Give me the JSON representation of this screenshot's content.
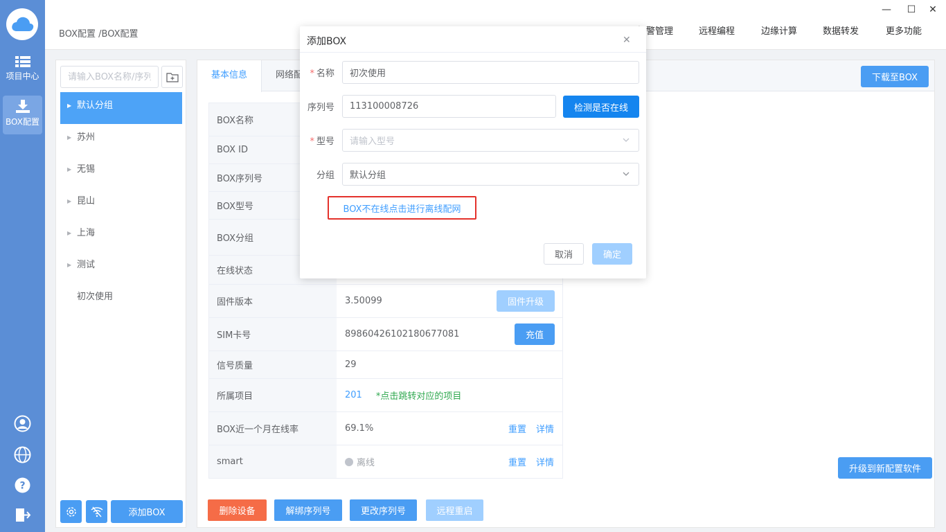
{
  "rail": {
    "items": [
      {
        "label": "项目中心"
      },
      {
        "label": "BOX配置"
      }
    ]
  },
  "topbar": {
    "breadcrumb": "BOX配置 /BOX配置",
    "nav": [
      "报警管理",
      "远程编程",
      "边缘计算",
      "数据转发",
      "更多功能"
    ]
  },
  "sidebar": {
    "search_placeholder": "请输入BOX名称/序列",
    "tree": [
      "默认分组",
      "苏州",
      "无锡",
      "昆山",
      "上海",
      "测试",
      "初次使用"
    ],
    "add_box_label": "添加BOX"
  },
  "main": {
    "tabs": [
      "基本信息",
      "网络配"
    ],
    "download_label": "下载至BOX",
    "upgrade_software_label": "升级到新配置软件",
    "rows": [
      {
        "label": "BOX名称",
        "value": ""
      },
      {
        "label": "BOX ID",
        "value": ""
      },
      {
        "label": "BOX序列号",
        "value": ""
      },
      {
        "label": "BOX型号",
        "value": ""
      },
      {
        "label": "BOX分组",
        "value": ""
      },
      {
        "label": "在线状态",
        "value": ""
      },
      {
        "label": "固件版本",
        "value": "3.50099",
        "action": "固件升级"
      },
      {
        "label": "SIM卡号",
        "value": "89860426102180677081",
        "action": "充值"
      },
      {
        "label": "信号质量",
        "value": "29"
      },
      {
        "label": "所属项目",
        "value": "201",
        "note": "*点击跳转对应的项目"
      },
      {
        "label": "BOX近一个月在线率",
        "value": "69.1%",
        "reset": "重置",
        "detail": "详情"
      },
      {
        "label": "smart",
        "value": "离线",
        "reset": "重置",
        "detail": "详情"
      }
    ],
    "bottom_buttons": {
      "delete": "删除设备",
      "unbind": "解绑序列号",
      "change_serial": "更改序列号",
      "remote_restart": "远程重启"
    }
  },
  "dialog": {
    "title": "添加BOX",
    "name_label": "名称",
    "name_value": "初次使用",
    "serial_label": "序列号",
    "serial_value": "113100008726",
    "check_online_label": "检测是否在线",
    "model_label": "型号",
    "model_placeholder": "请输入型号",
    "group_label": "分组",
    "group_value": "默认分组",
    "offline_link": "BOX不在线点击进行离线配网",
    "cancel_label": "取消",
    "confirm_label": "确定"
  },
  "colors": {
    "rail": "#5b8ed6",
    "primary": "#4a9df3",
    "danger": "#f56c47",
    "highlight_border": "#e4312b"
  }
}
